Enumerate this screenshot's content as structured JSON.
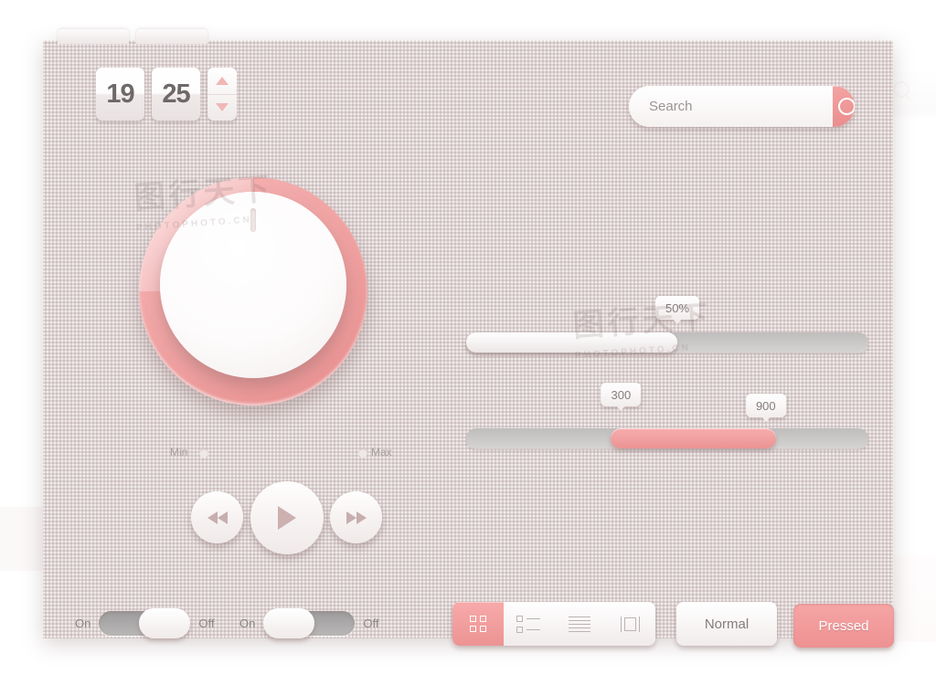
{
  "stepper": {
    "value_left": "19",
    "value_right": "25",
    "increment_icon": "triangle-up-icon",
    "decrement_icon": "triangle-down-icon"
  },
  "search": {
    "placeholder": "Search",
    "value": "",
    "button_icon": "magnifier-icon"
  },
  "knob": {
    "min_label": "Min",
    "max_label": "Max",
    "ring_color": "#f0a0a0",
    "face_color": "#ffffff"
  },
  "transport": {
    "previous_label": "rewind-icon",
    "play_label": "play-icon",
    "next_label": "fast-forward-icon"
  },
  "sliders": {
    "single": {
      "value_label": "50%",
      "percent": 50,
      "fill_color": "#ffffff",
      "track_color": "#c6c3c3"
    },
    "range": {
      "low_label": "300",
      "high_label": "900",
      "low_percent": 36,
      "high_percent": 77,
      "fill_color": "#f3a0a0",
      "track_color": "#c6c3c3"
    }
  },
  "toggles": [
    {
      "on_label": "On",
      "off_label": "Off",
      "state": "off"
    },
    {
      "on_label": "On",
      "off_label": "Off",
      "state": "on"
    }
  ],
  "segmented": {
    "items": [
      {
        "icon": "grid-view-icon",
        "active": true
      },
      {
        "icon": "list-view-icon",
        "active": false
      },
      {
        "icon": "lines-view-icon",
        "active": false
      },
      {
        "icon": "column-view-icon",
        "active": false
      }
    ],
    "active_color": "#f2a0a0"
  },
  "buttons": {
    "normal_label": "Normal",
    "pressed_label": "Pressed",
    "pressed_color": "#f29a9a"
  },
  "theme": {
    "panel_bg": "#ddd2d2",
    "accent": "#f09a9a",
    "text": "#857d7d"
  },
  "watermark": {
    "line1": "图行天下",
    "line2": "PHOTOPHOTO.CN"
  }
}
